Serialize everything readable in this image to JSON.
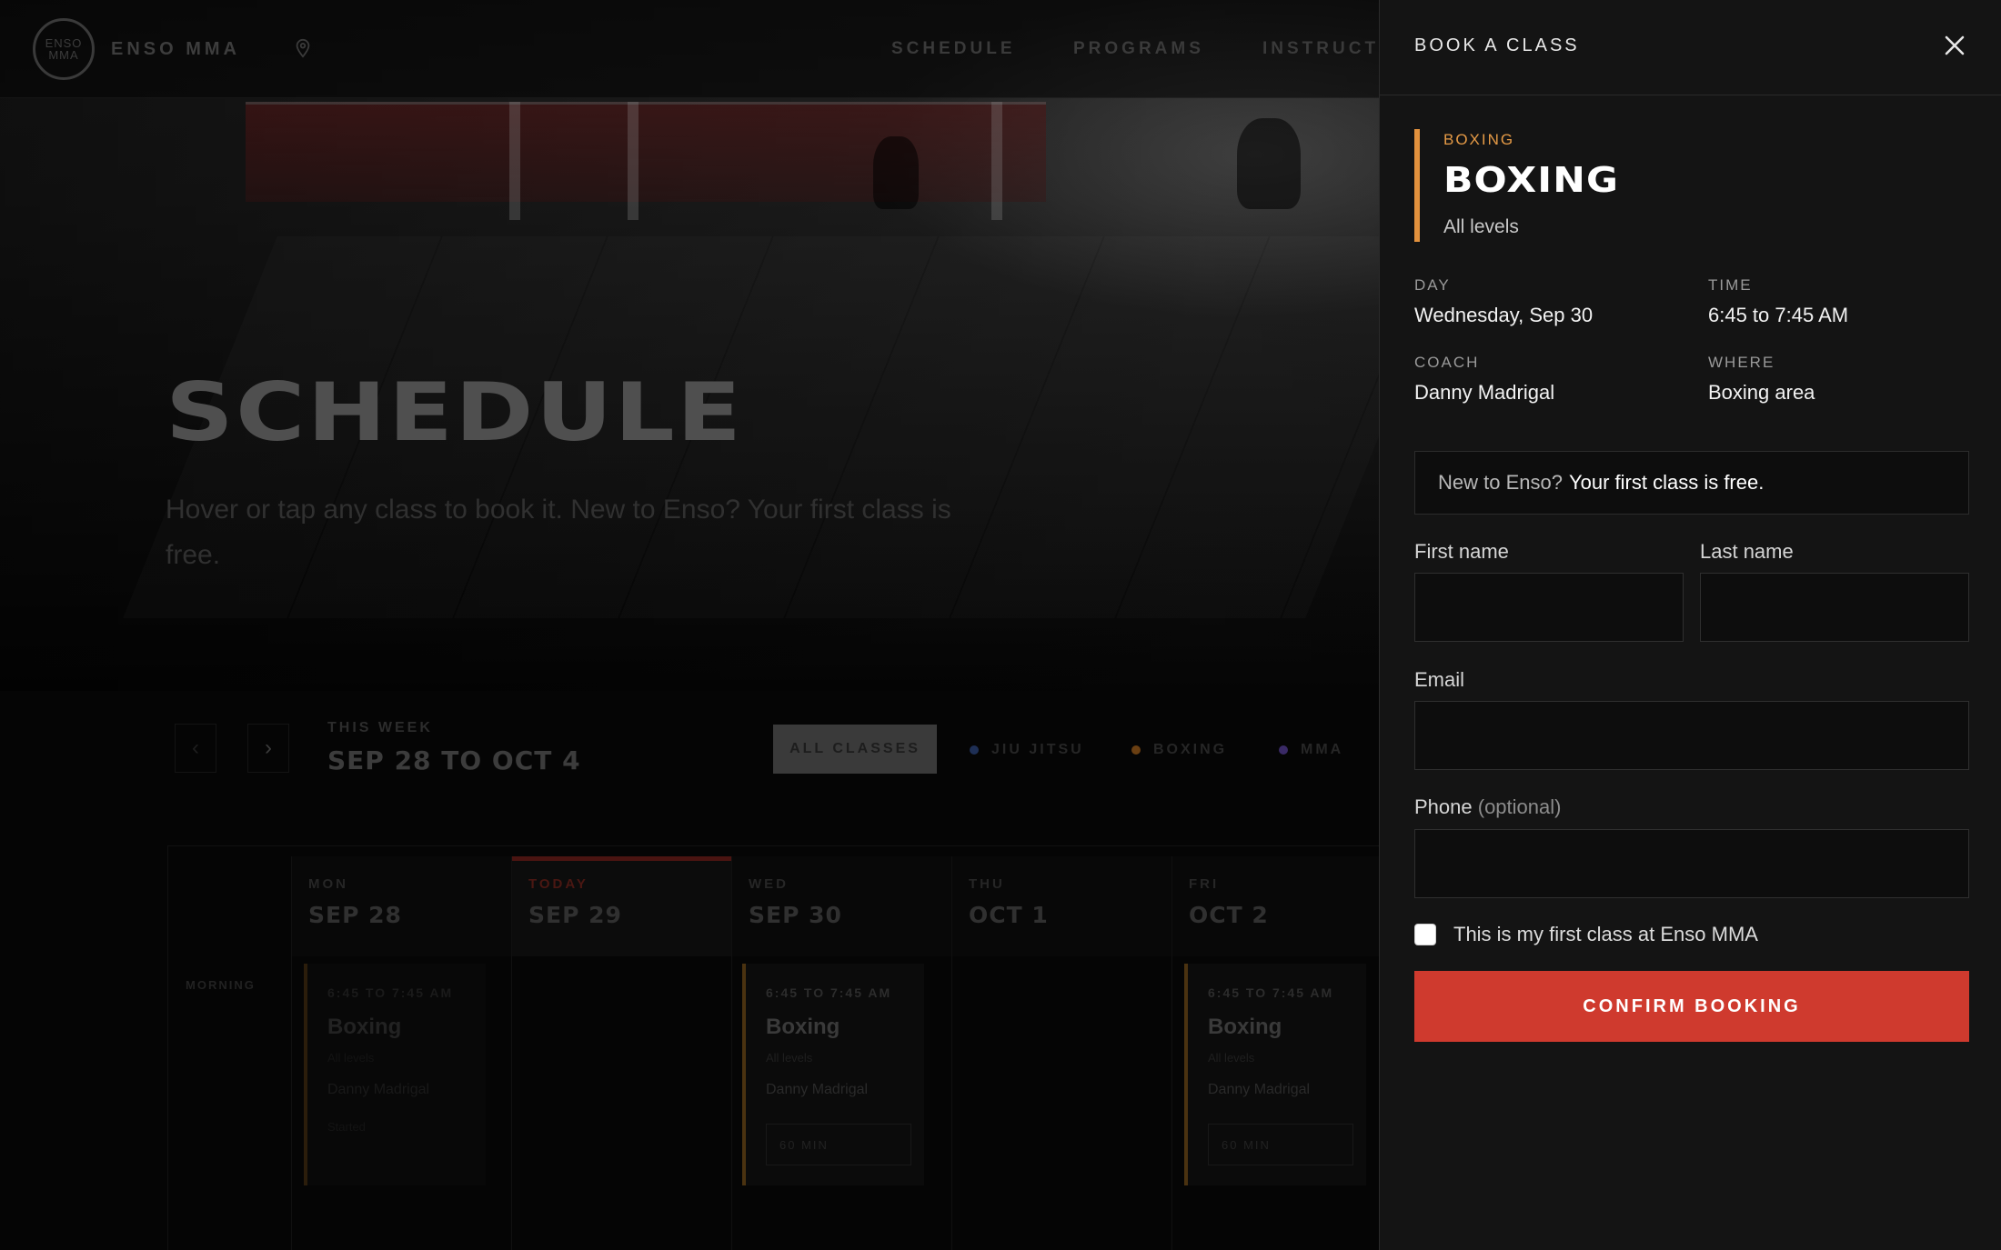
{
  "brand": {
    "name": "ENSO MMA",
    "logo_text": "ENSO MMA"
  },
  "nav": {
    "items": [
      "SCHEDULE",
      "PROGRAMS",
      "INSTRUCTORS"
    ]
  },
  "page": {
    "title": "SCHEDULE",
    "subtitle": "Hover or tap any class to book it. New to Enso? Your first class is free."
  },
  "week": {
    "kicker": "THIS WEEK",
    "range": "SEP 28 TO OCT 4",
    "prev_icon": "chevron-left-icon",
    "next_icon": "chevron-right-icon"
  },
  "filters": {
    "all_label": "ALL CLASSES",
    "items": [
      {
        "label": "JIU JITSU",
        "color": "#1e2f55"
      },
      {
        "label": "BOXING",
        "color": "#6a3f12"
      },
      {
        "label": "MMA",
        "color": "#3a2a66"
      }
    ]
  },
  "grid": {
    "gutter_label": "MORNING",
    "days": [
      {
        "dow": "MON",
        "date": "SEP 28"
      },
      {
        "dow": "TODAY",
        "date": "SEP 29"
      },
      {
        "dow": "WED",
        "date": "SEP 30"
      },
      {
        "dow": "THU",
        "date": "OCT 1"
      },
      {
        "dow": "FRI",
        "date": "OCT 2"
      }
    ],
    "cards": [
      {
        "time": "6:45 TO 7:45 AM",
        "name": "Boxing",
        "level": "All levels",
        "coach": "Danny Madrigal",
        "tag": "Started"
      },
      {
        "time": "6:45 TO 7:45 AM",
        "name": "Boxing",
        "level": "All levels",
        "coach": "Danny Madrigal",
        "tag": "60 MIN"
      },
      {
        "time": "6:45 TO 7:45 AM",
        "name": "Boxing",
        "level": "All levels",
        "coach": "Danny Madrigal",
        "tag": "60 MIN"
      }
    ]
  },
  "drawer": {
    "title": "BOOK A CLASS",
    "close_icon": "close-icon",
    "class": {
      "kicker": "BOXING",
      "name": "BOXING",
      "level": "All levels",
      "accent": "#e2913d"
    },
    "meta": {
      "day_label": "DAY",
      "day_value": "Wednesday, Sep 30",
      "time_label": "TIME",
      "time_value": "6:45 to 7:45 AM",
      "coach_label": "COACH",
      "coach_value": "Danny Madrigal",
      "where_label": "WHERE",
      "where_value": "Boxing area"
    },
    "promo": {
      "muted": "New to Enso?",
      "strong": "Your first class is free."
    },
    "form": {
      "first_name_label": "First name",
      "first_name_value": "",
      "last_name_label": "Last name",
      "last_name_value": "",
      "email_label": "Email",
      "email_value": "",
      "phone_label": "Phone",
      "phone_optional": "(optional)",
      "phone_value": "",
      "first_class_label": "This is my first class at Enso MMA",
      "first_class_checked": false
    },
    "confirm_label": "CONFIRM BOOKING",
    "confirm_color": "#cf3a2e"
  }
}
